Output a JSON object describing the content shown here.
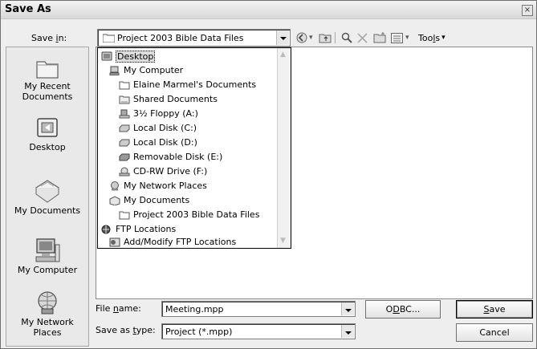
{
  "window": {
    "title": "Save As",
    "close_glyph": "×"
  },
  "save_in": {
    "label_pre": "Save ",
    "label_key": "i",
    "label_post": "n:",
    "value": "Project 2003 Bible Data Files"
  },
  "toolbar": {
    "tools_pre": "Too",
    "tools_key": "l",
    "tools_post": "s",
    "tools_arrow": "▾",
    "back_arrow": "▾",
    "views_arrow": "▾"
  },
  "places": [
    {
      "label": "My Recent Documents",
      "icon": "recent-documents-icon"
    },
    {
      "label": "Desktop",
      "icon": "desktop-icon"
    },
    {
      "label": "My Documents",
      "icon": "my-documents-icon"
    },
    {
      "label": "My Computer",
      "icon": "my-computer-icon"
    },
    {
      "label": "My Network Places",
      "icon": "network-places-icon"
    }
  ],
  "save_in_dropdown": [
    {
      "label": "Desktop",
      "icon": "desktop-icon",
      "selected": true
    },
    {
      "label": "My Computer",
      "icon": "my-computer-icon"
    },
    {
      "label": "Elaine Marmel's Documents",
      "icon": "folder-icon"
    },
    {
      "label": "Shared Documents",
      "icon": "folder-icon"
    },
    {
      "label": "3½ Floppy (A:)",
      "icon": "floppy-drive-icon"
    },
    {
      "label": "Local Disk (C:)",
      "icon": "hard-disk-icon"
    },
    {
      "label": "Local Disk (D:)",
      "icon": "hard-disk-icon"
    },
    {
      "label": "Removable Disk (E:)",
      "icon": "removable-disk-icon"
    },
    {
      "label": "CD-RW Drive (F:)",
      "icon": "cd-drive-icon"
    },
    {
      "label": "My Network Places",
      "icon": "network-places-icon"
    },
    {
      "label": "My Documents",
      "icon": "my-documents-icon"
    },
    {
      "label": "Project 2003 Bible Data Files",
      "icon": "folder-icon"
    },
    {
      "label": "FTP Locations",
      "icon": "ftp-icon"
    },
    {
      "label": "Add/Modify FTP Locations",
      "icon": "ftp-add-icon"
    }
  ],
  "file_name": {
    "label_pre": "File ",
    "label_key": "n",
    "label_post": "ame:",
    "value": "Meeting.mpp"
  },
  "save_as_type": {
    "label_pre": "Save as ",
    "label_key": "t",
    "label_post": "ype:",
    "value": "Project (*.mpp)"
  },
  "buttons": {
    "odbc_pre": "O",
    "odbc_key": "D",
    "odbc_post": "BC...",
    "save_key": "S",
    "save_post": "ave",
    "cancel": "Cancel"
  }
}
